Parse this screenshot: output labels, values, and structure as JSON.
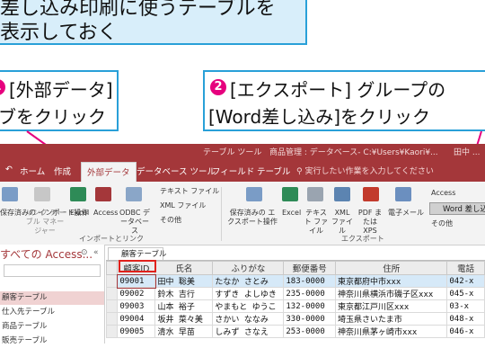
{
  "callout": {
    "line1": "差し込み印刷に使うテーブルを",
    "line2": "表示しておく"
  },
  "steps": [
    {
      "number": "1",
      "line1": "[外部データ]",
      "line2": "ブをクリック"
    },
    {
      "number": "2",
      "line1": "[エクスポート] グループの",
      "line2": "[Word差し込み]をクリック"
    }
  ],
  "titlebar": {
    "context_tab": "テーブル ツール",
    "title": "商品管理 : データベース- C:¥Users¥Kaori¥...",
    "user": "田中 ..."
  },
  "tabs": [
    "ホーム",
    "作成",
    "外部データ",
    "データベース ツール",
    "フィールド",
    "テーブル"
  ],
  "active_tab": "外部データ",
  "tell_me": "実行したい作業を入力してください",
  "ribbon": {
    "import_group": "インポートとリンク",
    "export_group": "エクスポート",
    "import_buttons": [
      "保存済みの インポート操作",
      "リンク テーブル マネージャー",
      "Excel",
      "Access",
      "ODBC データベース"
    ],
    "import_small": [
      "テキスト ファイル",
      "XML ファイル",
      "その他"
    ],
    "export_buttons": [
      "保存済みの エクスポート操作",
      "Excel",
      "テキスト ファイル",
      "XML ファイル",
      "PDF または XPS",
      "電子メール"
    ],
    "export_small": [
      "Access",
      "Word 差し込み",
      "その他"
    ]
  },
  "nav": {
    "title": "すべての Access...",
    "items": [
      "顧客テーブル",
      "仕入先テーブル",
      "商品テーブル",
      "販売テーブル"
    ]
  },
  "doc_tab": "顧客テーブル",
  "table": {
    "headers": [
      "顧客ID",
      "氏名",
      "ふりがな",
      "郵便番号",
      "住所",
      "電話"
    ],
    "rows": [
      [
        "09001",
        "田中 聡美",
        "たなか さとみ",
        "183-0000",
        "東京都府中市xxx",
        "042-x"
      ],
      [
        "09002",
        "鈴木 吉行",
        "すずき よしゆき",
        "235-0000",
        "神奈川県横浜市磯子区xxx",
        "045-x"
      ],
      [
        "09003",
        "山本 裕子",
        "やまもと ゆうこ",
        "132-0000",
        "東京都江戸川区xxx",
        "03-x"
      ],
      [
        "09004",
        "坂井 菜々美",
        "さかい ななみ",
        "330-0000",
        "埼玉県さいたま市",
        "048-x"
      ],
      [
        "09005",
        "清水 早苗",
        "しみず さなえ",
        "253-0000",
        "神奈川県茅ヶ崎市xxx",
        "046-x"
      ]
    ]
  },
  "colors": {
    "accent": "#a4373a",
    "callout_bg": "#d8eefa",
    "callout_border": "#29a0d8",
    "badge": "#e6007e",
    "highlight": "#e0211c"
  }
}
